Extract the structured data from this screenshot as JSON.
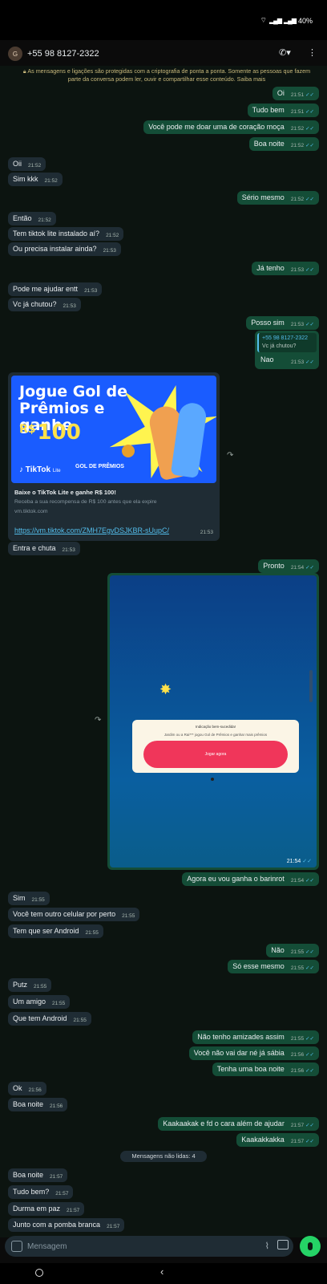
{
  "status": {
    "battery": "40%"
  },
  "header": {
    "avatar_letter": "G",
    "contact_name": "+55 98 8127-2322"
  },
  "encryption_notice": "As mensagens e ligações são protegidas com a criptografia de ponta a ponta. Somente as pessoas que fazem parte da conversa podem ler, ouvir e compartilhar esse conteúdo. Saiba mais",
  "messages": [
    {
      "text": "Oi",
      "time": "21:51"
    },
    {
      "text": "Tudo bem",
      "time": "21:51"
    },
    {
      "text": "Você pode me doar uma de coração moça",
      "time": "21:52"
    },
    {
      "text": "Boa noite",
      "time": "21:52"
    },
    {
      "text": "Oii",
      "time": "21:52"
    },
    {
      "text": "Sim kkk",
      "time": "21:52"
    },
    {
      "text": "Sério mesmo",
      "time": "21:52"
    },
    {
      "text": "Então",
      "time": "21:52"
    },
    {
      "text": "Tem tiktok lite instalado aí?",
      "time": "21:52"
    },
    {
      "text": "Ou precisa instalar ainda?",
      "time": "21:53"
    },
    {
      "text": "Já tenho",
      "time": "21:53"
    },
    {
      "text": "Pode me ajudar entt",
      "time": "21:53"
    },
    {
      "text": "Vc já chutou?",
      "time": "21:53"
    },
    {
      "text": "Posso sim",
      "time": "21:53"
    },
    {
      "text": "Entra e chuta",
      "time": "21:53"
    },
    {
      "text": "Pronto",
      "time": "21:54"
    },
    {
      "text": "Agora eu vou ganha o barinrot",
      "time": "21:54"
    },
    {
      "text": "Sim",
      "time": "21:55"
    },
    {
      "text": "Você tem outro celular por perto",
      "time": "21:55"
    },
    {
      "text": "Tem que ser Android",
      "time": "21:55"
    },
    {
      "text": "Não",
      "time": "21:55"
    },
    {
      "text": "Só esse mesmo",
      "time": "21:55"
    },
    {
      "text": "Putz",
      "time": "21:55"
    },
    {
      "text": "Um amigo",
      "time": "21:55"
    },
    {
      "text": "Que tem Android",
      "time": "21:55"
    },
    {
      "text": "Não tenho amizades assim",
      "time": "21:55"
    },
    {
      "text": "Você não vai dar né já sábia",
      "time": "21:56"
    },
    {
      "text": "Tenha uma boa noite",
      "time": "21:56"
    },
    {
      "text": "Ok",
      "time": "21:56"
    },
    {
      "text": "Boa noite",
      "time": "21:56"
    },
    {
      "text": "Kaakaakak e fd o cara além de ajudar",
      "time": "21:57"
    },
    {
      "text": "Kaakakkakka",
      "time": "21:57"
    },
    {
      "text": "Boa noite",
      "time": "21:57"
    },
    {
      "text": "Tudo bem?",
      "time": "21:57"
    },
    {
      "text": "Durma em paz",
      "time": "21:57"
    },
    {
      "text": "Junto com a pomba branca",
      "time": "21:57"
    }
  ],
  "reply": {
    "quoted_name": "+55 98 8127-2322",
    "quoted_text": "Vc já chutou?",
    "text": "Nao",
    "time": "21:53"
  },
  "promo": {
    "banner_title": "Jogue Gol de Prêmios e ganhe",
    "currency": "R$",
    "amount": "100",
    "logo": "TikTok",
    "logo_suffix": "Lite",
    "badge": "GOL DE PRÊMIOS",
    "headline": "Baixe o TikTok Lite e ganhe R$ 100!",
    "description": "Receba a sua recompensa de R$ 100 antes que ela expire",
    "domain": "vm.tiktok.com",
    "link": "https://vm.tiktok.com/ZMH7EgvDSJKBR-sUupC/",
    "time": "21:53"
  },
  "screenshot": {
    "dialog_line1": "Indicação bem-sucedida!",
    "dialog_line2": "Jardim ou a Rai*** jogou Gol de Prêmios e ganhar mais prêmios",
    "dialog_button": "Jogar agora",
    "time": "21:54"
  },
  "unread_divider": "Mensagens não lidas: 4",
  "composer": {
    "placeholder": "Mensagem"
  },
  "colors": {
    "outgoing": "#144d37",
    "incoming": "#1f2c34",
    "read_ticks": "#53bdeb",
    "mic_button": "#25d366"
  }
}
